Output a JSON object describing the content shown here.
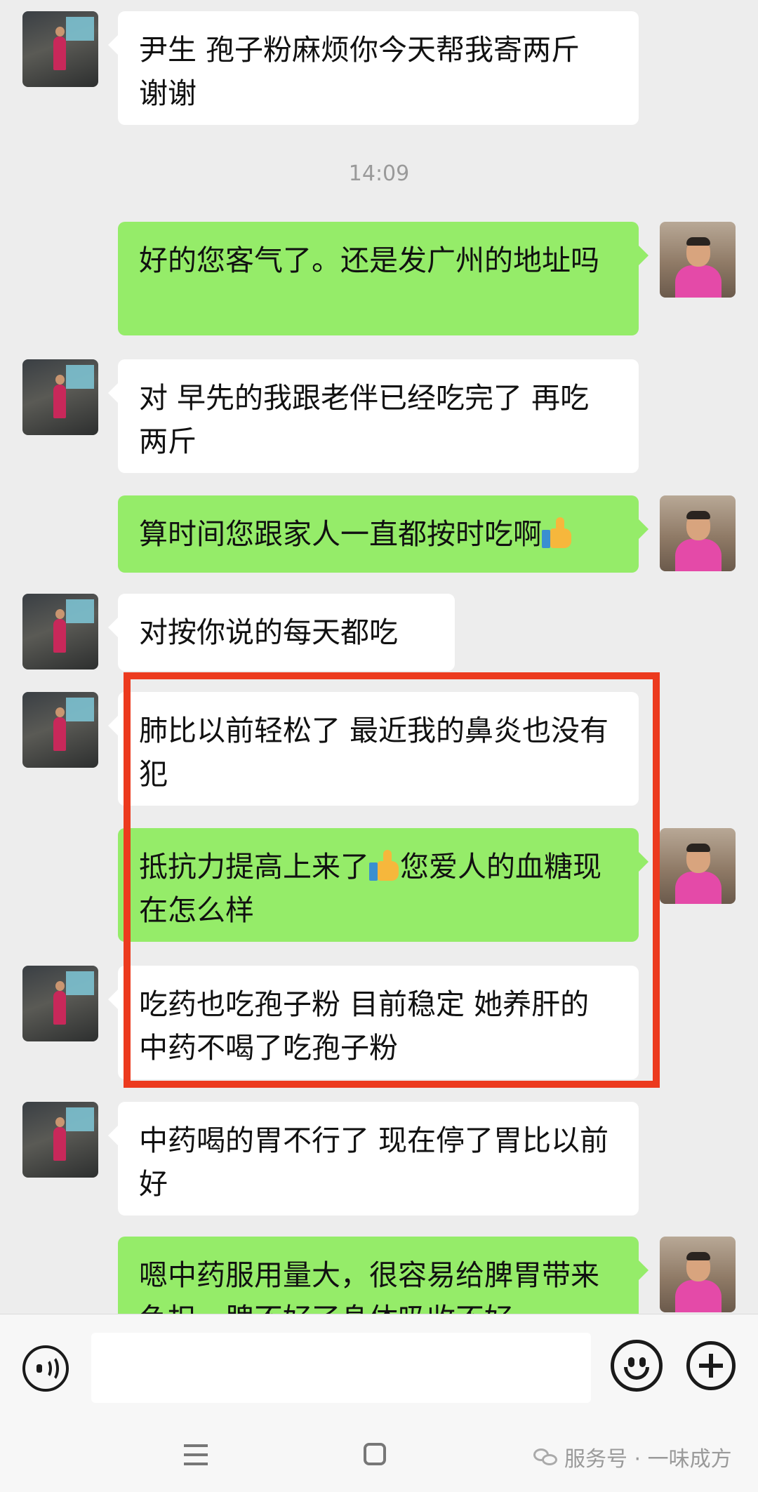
{
  "timestamp": "14:09",
  "messages": [
    {
      "from": "other",
      "text": "尹生 孢子粉麻烦你今天帮我寄两斤 谢谢"
    },
    {
      "from": "self",
      "text": "好的您客气了。还是发广州的地址吗"
    },
    {
      "from": "other",
      "text": "对 早先的我跟老伴已经吃完了 再吃两斤"
    },
    {
      "from": "self",
      "text_before": "算时间您跟家人一直都按时吃啊",
      "emoji": "thumbs-up"
    },
    {
      "from": "other",
      "text": "对按你说的每天都吃"
    },
    {
      "from": "other",
      "text": "肺比以前轻松了 最近我的鼻炎也没有犯"
    },
    {
      "from": "self",
      "text_before": "抵抗力提高上来了",
      "emoji": "thumbs-up",
      "text_after": "您爱人的血糖现在怎么样"
    },
    {
      "from": "other",
      "text": "吃药也吃孢子粉 目前稳定 她养肝的中药不喝了吃孢子粉"
    },
    {
      "from": "other",
      "text": "中药喝的胃不行了 现在停了胃比以前好"
    },
    {
      "from": "self",
      "text": "嗯中药服用量大，很容易给脾胃带来负担，脾不好了身体吸收不好"
    }
  ],
  "input": {
    "value": ""
  },
  "watermark": {
    "text": "服务号 · 一味成方"
  },
  "colors": {
    "incoming": "#ffffff",
    "outgoing": "#95ec69",
    "background": "#ededed",
    "highlight": "#ec3a1e"
  }
}
